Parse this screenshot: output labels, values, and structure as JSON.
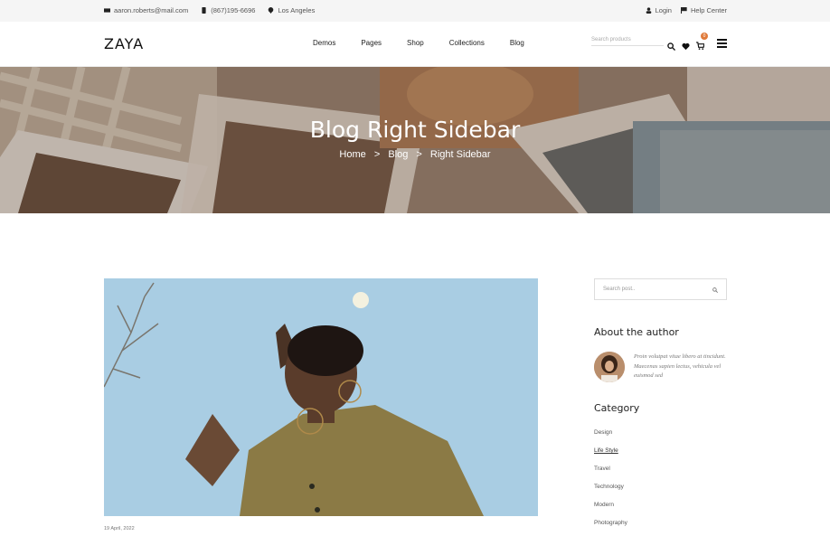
{
  "topbar": {
    "email": "aaron.roberts@mail.com",
    "phone": "(867)195-6696",
    "location": "Los Angeles",
    "login": "Login",
    "help": "Help Center"
  },
  "header": {
    "logo": "ZAYA",
    "nav": [
      "Demos",
      "Pages",
      "Shop",
      "Collections",
      "Blog"
    ],
    "search_placeholder": "Search products",
    "cart_count": "0"
  },
  "hero": {
    "title": "Blog Right Sidebar",
    "breadcrumb": [
      "Home",
      ">",
      "Blog",
      ">",
      "Right Sidebar"
    ]
  },
  "post": {
    "date": "19 April, 2022"
  },
  "sidebar": {
    "search_placeholder": "Search post..",
    "about_title": "About the author",
    "about_text": "Proin volutpat vitae libero at tincidunt. Maecenas sapien lectus, vehicula vel euismod sed",
    "category_title": "Category",
    "categories": [
      "Design",
      "Life Style",
      "Travel",
      "Technology",
      "Modern",
      "Photography"
    ]
  }
}
